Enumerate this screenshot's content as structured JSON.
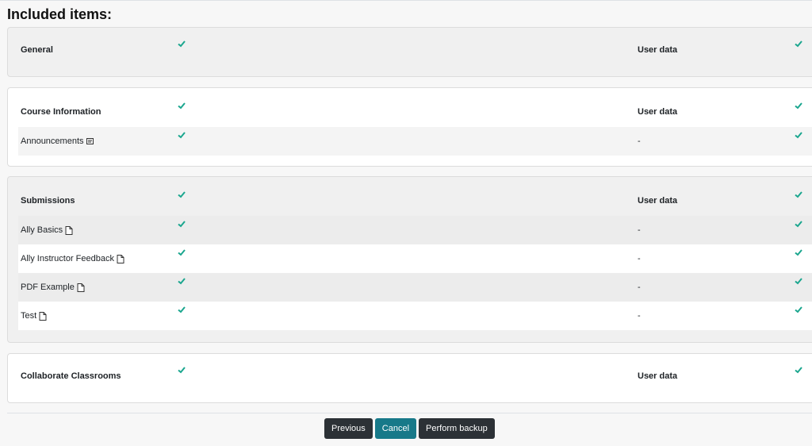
{
  "heading": "Included items:",
  "user_data_label": "User data",
  "dash": "-",
  "sections": [
    {
      "title": "General",
      "rows": []
    },
    {
      "title": "Course Information",
      "rows": [
        {
          "label": "Announcements",
          "icon": "forum-icon"
        }
      ]
    },
    {
      "title": "Submissions",
      "rows": [
        {
          "label": "Ally Basics",
          "icon": "file-icon"
        },
        {
          "label": "Ally Instructor Feedback",
          "icon": "file-icon"
        },
        {
          "label": "PDF Example",
          "icon": "file-icon"
        },
        {
          "label": "Test",
          "icon": "file-icon"
        }
      ]
    },
    {
      "title": "Collaborate Classrooms",
      "rows": []
    }
  ],
  "buttons": {
    "previous": "Previous",
    "cancel": "Cancel",
    "perform": "Perform backup"
  },
  "colors": {
    "check": "#1aa68e",
    "cancel_button": "#177989",
    "dark_button": "#2c3136"
  }
}
